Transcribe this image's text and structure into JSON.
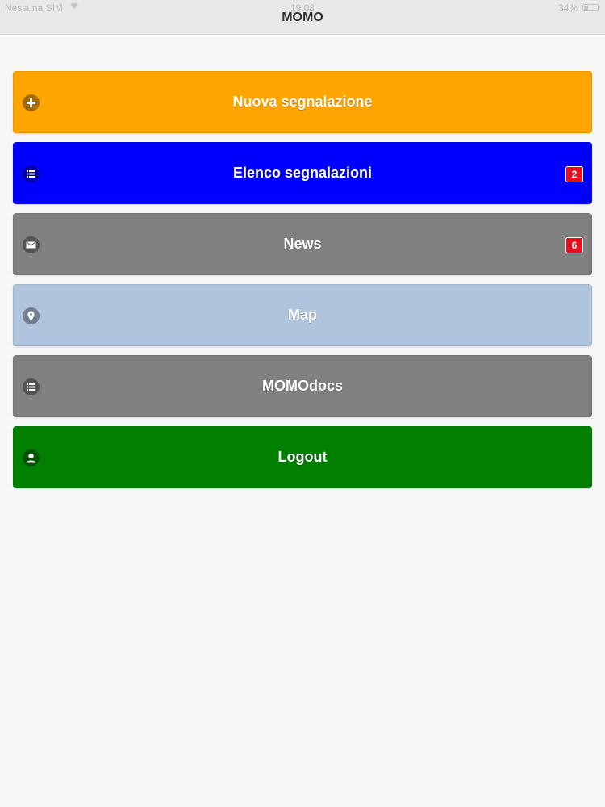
{
  "status_bar": {
    "carrier": "Nessuna SIM",
    "time": "19:08",
    "battery": "34%"
  },
  "header": {
    "title": "MOMO"
  },
  "colors": {
    "nuova": "#ffa500",
    "elenco": "#0000fe",
    "news": "#808080",
    "map": "#b0c4de",
    "momodocs": "#808080",
    "logout": "#017f01",
    "icon_disc": "rgba(0,0,0,0.35)",
    "badge": "#e5101d"
  },
  "menu": {
    "items": [
      {
        "label": "Nuova segnalazione",
        "icon": "plus-icon",
        "badge": null
      },
      {
        "label": "Elenco segnalazioni",
        "icon": "list-icon",
        "badge": "2"
      },
      {
        "label": "News",
        "icon": "mail-icon",
        "badge": "6"
      },
      {
        "label": "Map",
        "icon": "location-pin-icon",
        "badge": null
      },
      {
        "label": "MOMOdocs",
        "icon": "list-icon",
        "badge": null
      },
      {
        "label": "Logout",
        "icon": "user-icon",
        "badge": null
      }
    ]
  }
}
